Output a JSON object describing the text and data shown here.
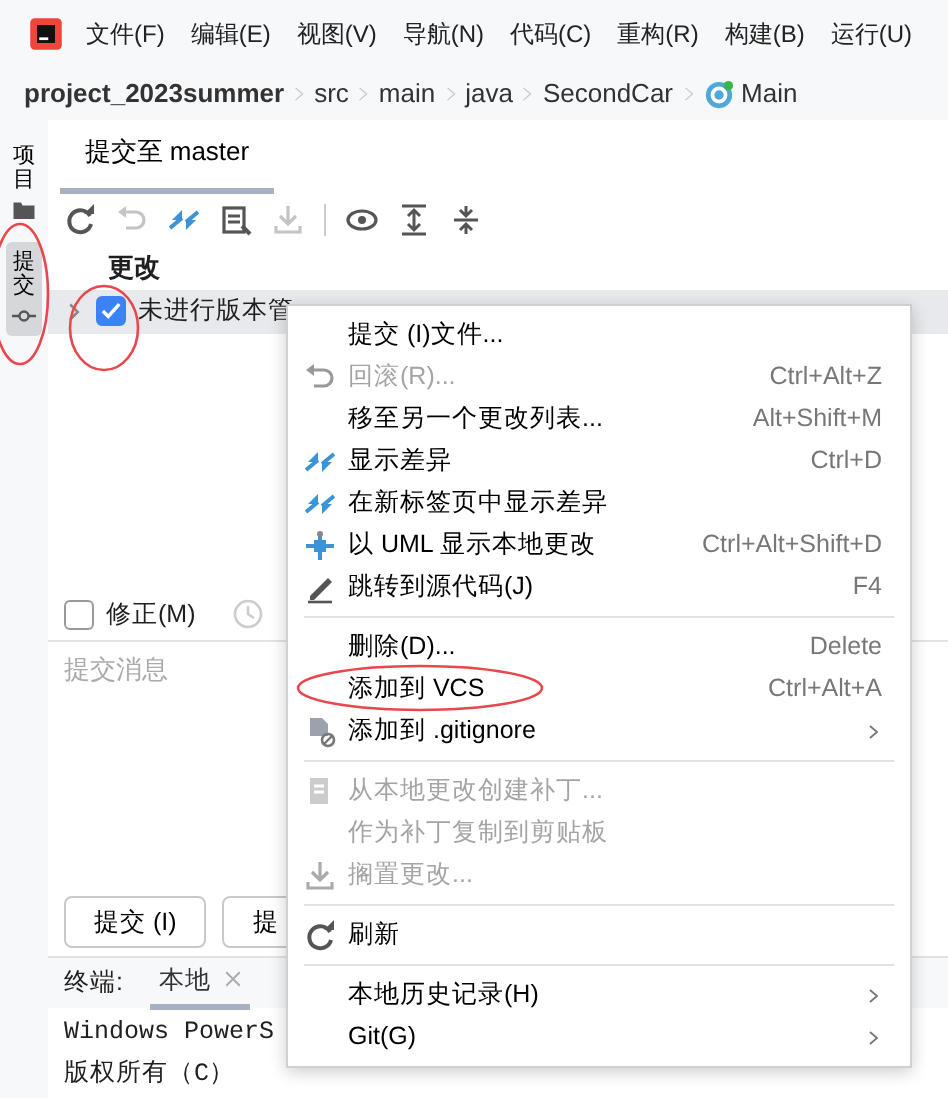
{
  "menu_bar": {
    "items": [
      "文件(F)",
      "编辑(E)",
      "视图(V)",
      "导航(N)",
      "代码(C)",
      "重构(R)",
      "构建(B)",
      "运行(U)"
    ]
  },
  "breadcrumb": [
    {
      "label": "project_2023summer",
      "kind": "project"
    },
    {
      "label": "src",
      "kind": "folder"
    },
    {
      "label": "main",
      "kind": "folder"
    },
    {
      "label": "java",
      "kind": "folder"
    },
    {
      "label": "SecondCar",
      "kind": "folder"
    },
    {
      "label": "Main",
      "kind": "class"
    }
  ],
  "side_tabs": [
    {
      "label": "项目",
      "selected": false,
      "circled": false
    },
    {
      "label": "提交",
      "selected": true,
      "circled": true
    }
  ],
  "commit_panel": {
    "tabs": [
      {
        "label": "提交至 master",
        "selected": true
      }
    ],
    "toolbar": [
      {
        "disabled": false
      },
      {
        "disabled": true
      },
      {
        "disabled": false
      },
      {
        "disabled": false
      },
      {
        "disabled": true
      },
      {
        "disabled": false
      },
      {
        "disabled": false
      },
      {
        "disabled": false
      }
    ],
    "changes_header": "更改",
    "changelists": [
      {
        "label": "未进行版本管",
        "checked": true,
        "expanded": false,
        "circled": true
      }
    ],
    "amend": {
      "label": "修正(M)",
      "checked": false
    },
    "message": {
      "placeholder": "提交消息"
    },
    "buttons": [
      "提交 (I)",
      "提"
    ]
  },
  "terminal": {
    "label": "终端:",
    "tabs": [
      {
        "label": "本地",
        "selected": true
      }
    ],
    "lines": [
      "Windows PowerS",
      "版权所有（C）"
    ]
  },
  "context_menu": {
    "items": [
      {
        "kind": "item",
        "label": "提交 (I)文件...",
        "disabled": false,
        "submenu": false,
        "circled": false
      },
      {
        "kind": "item",
        "label": "回滚(R)...",
        "shortcut": "Ctrl+Alt+Z",
        "disabled": true,
        "submenu": false,
        "circled": false
      },
      {
        "kind": "item",
        "label": "移至另一个更改列表...",
        "shortcut": "Alt+Shift+M",
        "disabled": false,
        "submenu": false,
        "circled": false
      },
      {
        "kind": "item",
        "label": "显示差异",
        "shortcut": "Ctrl+D",
        "disabled": false,
        "submenu": false,
        "circled": false
      },
      {
        "kind": "item",
        "label": "在新标签页中显示差异",
        "disabled": false,
        "submenu": false,
        "circled": false
      },
      {
        "kind": "item",
        "label": "以 UML 显示本地更改",
        "shortcut": "Ctrl+Alt+Shift+D",
        "disabled": false,
        "submenu": false,
        "circled": false
      },
      {
        "kind": "item",
        "label": "跳转到源代码(J)",
        "shortcut": "F4",
        "disabled": false,
        "submenu": false,
        "circled": false
      },
      {
        "kind": "separator"
      },
      {
        "kind": "item",
        "label": "删除(D)...",
        "shortcut": "Delete",
        "disabled": false,
        "submenu": false,
        "circled": false
      },
      {
        "kind": "item",
        "label": "添加到 VCS",
        "shortcut": "Ctrl+Alt+A",
        "disabled": false,
        "submenu": false,
        "circled": true
      },
      {
        "kind": "item",
        "label": "添加到 .gitignore",
        "disabled": false,
        "submenu": true,
        "circled": false
      },
      {
        "kind": "separator"
      },
      {
        "kind": "item",
        "label": "从本地更改创建补丁...",
        "disabled": true,
        "submenu": false,
        "circled": false
      },
      {
        "kind": "item",
        "label": "作为补丁复制到剪贴板",
        "disabled": true,
        "submenu": false,
        "circled": false
      },
      {
        "kind": "item",
        "label": "搁置更改...",
        "disabled": true,
        "submenu": false,
        "circled": false
      },
      {
        "kind": "separator"
      },
      {
        "kind": "item",
        "label": "刷新",
        "disabled": false,
        "submenu": false,
        "circled": false
      },
      {
        "kind": "separator"
      },
      {
        "kind": "item",
        "label": "本地历史记录(H)",
        "disabled": false,
        "submenu": true,
        "circled": false
      },
      {
        "kind": "item",
        "label": "Git(G)",
        "disabled": false,
        "submenu": true,
        "circled": false
      }
    ]
  }
}
